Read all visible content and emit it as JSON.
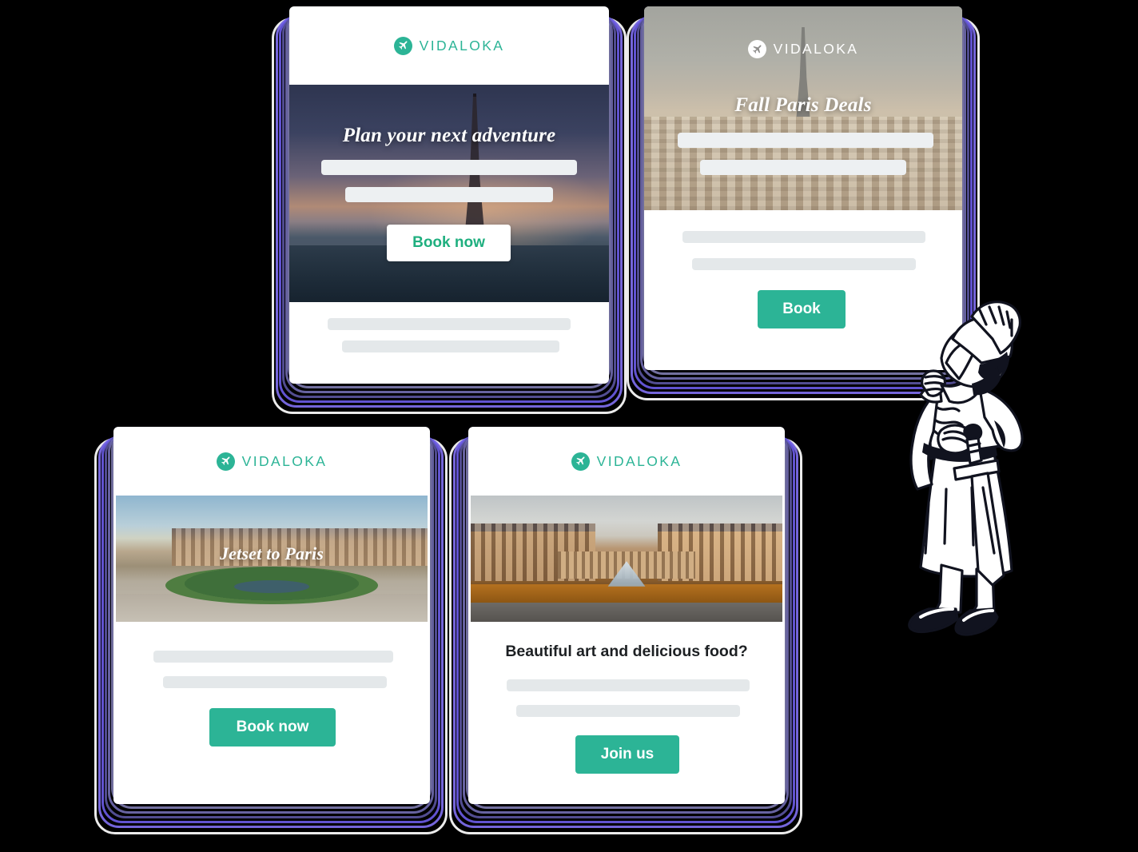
{
  "brand": {
    "name": "VIDALOKA",
    "logo_icon": "airplane-icon",
    "accent_green": "#2CB496",
    "accent_purple": "#6C5CE7",
    "skeleton_gray": "#E4E8EA"
  },
  "cards": [
    {
      "id": "card-plan-adventure",
      "logo_placement": "above-hero",
      "logo_text": "VIDALOKA",
      "hero_title": "Plan your next adventure",
      "hero_image": "eiffel-tower-dusk-seine",
      "hero_bars": 2,
      "button": {
        "label": "Book now",
        "style": "white"
      },
      "body_bars": 2
    },
    {
      "id": "card-fall-paris-deals",
      "logo_placement": "on-hero",
      "logo_text": "VIDALOKA",
      "hero_title": "Fall Paris Deals",
      "hero_image": "paris-rooftops-eiffel-grey",
      "hero_bars": 2,
      "button": {
        "label": "Book",
        "style": "green"
      },
      "body_bars": 2
    },
    {
      "id": "card-jetset-to-paris",
      "logo_placement": "above-hero",
      "logo_text": "VIDALOKA",
      "hero_title": "Jetset to Paris",
      "hero_image": "tuileries-garden-louvre",
      "hero_bars": 0,
      "button": {
        "label": "Book now",
        "style": "green"
      },
      "body_bars": 2
    },
    {
      "id": "card-beautiful-art",
      "logo_placement": "above-hero",
      "logo_text": "VIDALOKA",
      "hero_title": "",
      "hero_image": "louvre-pyramid-courtyard",
      "hero_bars": 0,
      "headline": "Beautiful art and delicious food?",
      "button": {
        "label": "Join us",
        "style": "green"
      },
      "body_bars": 2
    }
  ],
  "mascot": {
    "name": "thinking-warrior-illustration",
    "description": "line-art warrior with helmet and sword, hand on chin"
  }
}
